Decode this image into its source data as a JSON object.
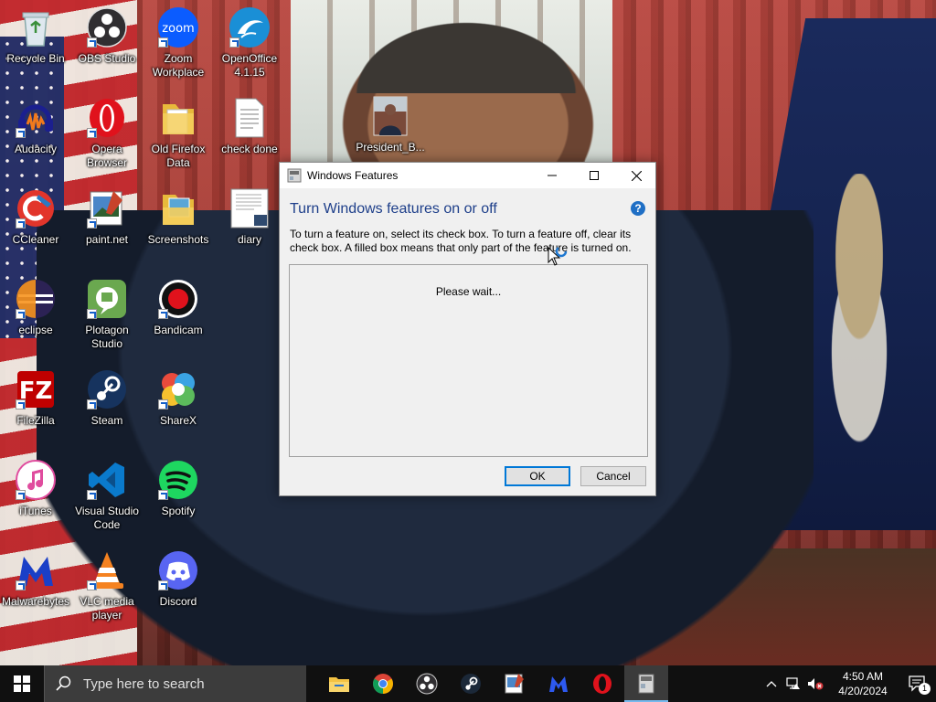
{
  "desktop": {
    "icons": [
      {
        "label": "Recycle Bin",
        "icon": "recycle-bin-icon"
      },
      {
        "label": "OBS Studio",
        "icon": "obs-icon"
      },
      {
        "label": "Zoom Workplace",
        "icon": "zoom-icon"
      },
      {
        "label": "OpenOffice 4.1.15",
        "icon": "openoffice-icon"
      },
      {
        "label": "Audacity",
        "icon": "audacity-icon"
      },
      {
        "label": "Opera Browser",
        "icon": "opera-icon"
      },
      {
        "label": "Old Firefox Data",
        "icon": "folder-icon"
      },
      {
        "label": "check done",
        "icon": "text-file-icon"
      },
      {
        "label": "President_B...",
        "icon": "image-file-icon"
      },
      {
        "label": "CCleaner",
        "icon": "ccleaner-icon"
      },
      {
        "label": "paint.net",
        "icon": "paintnet-icon"
      },
      {
        "label": "Screenshots",
        "icon": "folder-icon"
      },
      {
        "label": "diary",
        "icon": "document-icon"
      },
      {
        "label": "eclipse",
        "icon": "eclipse-icon"
      },
      {
        "label": "Plotagon Studio",
        "icon": "plotagon-icon"
      },
      {
        "label": "Bandicam",
        "icon": "bandicam-icon"
      },
      {
        "label": "FileZilla",
        "icon": "filezilla-icon"
      },
      {
        "label": "Steam",
        "icon": "steam-icon"
      },
      {
        "label": "ShareX",
        "icon": "sharex-icon"
      },
      {
        "label": "iTunes",
        "icon": "itunes-icon"
      },
      {
        "label": "Visual Studio Code",
        "icon": "vscode-icon"
      },
      {
        "label": "Spotify",
        "icon": "spotify-icon"
      },
      {
        "label": "Malwarebytes",
        "icon": "malwarebytes-icon"
      },
      {
        "label": "VLC media player",
        "icon": "vlc-icon"
      },
      {
        "label": "Discord",
        "icon": "discord-icon"
      }
    ]
  },
  "dialog": {
    "title": "Windows Features",
    "heading": "Turn Windows features on or off",
    "help_symbol": "?",
    "description": "To turn a feature on, select its check box. To turn a feature off, clear its check box. A filled box means that only part of the feature is turned on.",
    "status": "Please wait...",
    "ok_label": "OK",
    "cancel_label": "Cancel"
  },
  "taskbar": {
    "search_placeholder": "Type here to search",
    "pinned": [
      "file-explorer-icon",
      "chrome-icon",
      "obs-icon",
      "steam-icon",
      "paintnet-icon",
      "malwarebytes-icon",
      "opera-icon",
      "windows-features-icon"
    ],
    "active_app": "windows-features-icon",
    "clock_time": "4:50 AM",
    "clock_date": "4/20/2024",
    "notification_count": "1"
  },
  "colors": {
    "taskbar_bg": "#101010",
    "accent": "#0078d7",
    "heading": "#1e3f8a"
  }
}
